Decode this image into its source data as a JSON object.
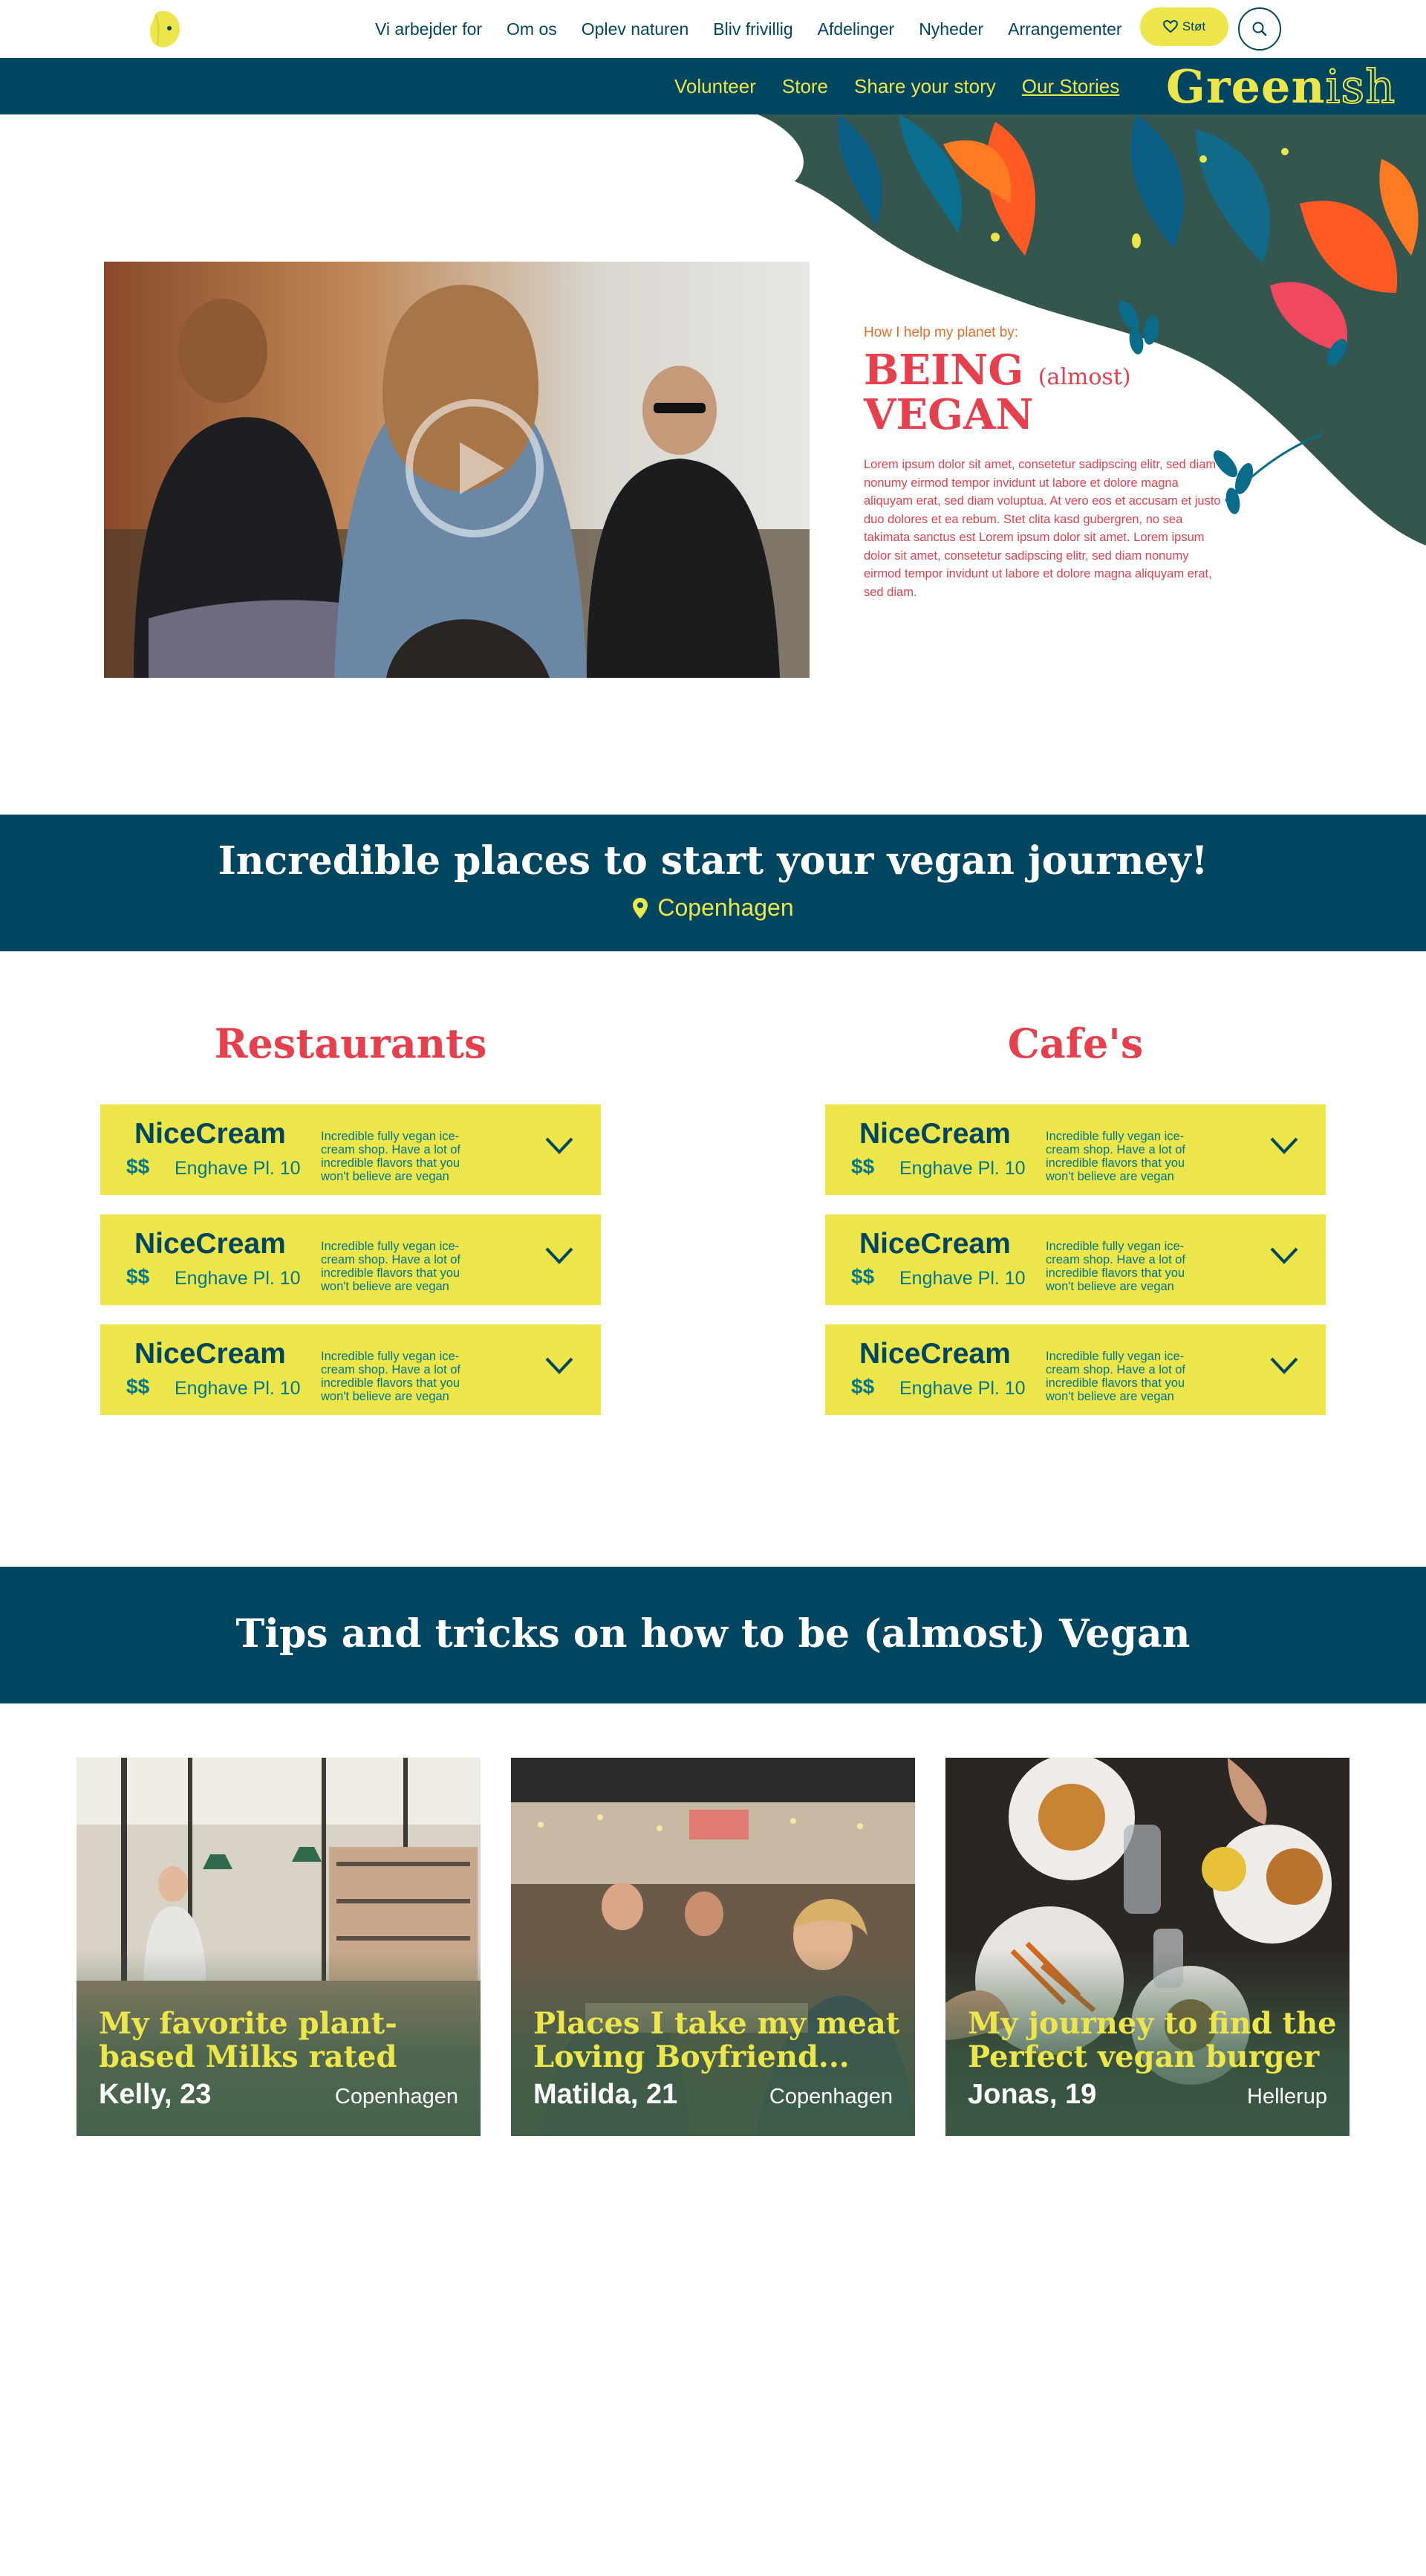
{
  "top_nav": {
    "items": [
      "Vi arbejder for",
      "Om os",
      "Oplev naturen",
      "Bliv frivillig",
      "Afdelinger",
      "Nyheder",
      "Arrangementer"
    ],
    "support_label": "Støt"
  },
  "sub_nav": {
    "items": [
      "Volunteer",
      "Store",
      "Share your story",
      "Our Stories"
    ],
    "active": "Our Stories",
    "brand_main": "Green",
    "brand_suffix": "ish"
  },
  "hero": {
    "kicker": "How I help my planet by:",
    "title_line1": "BEING",
    "title_aside": "(almost)",
    "title_line2": "VEGAN",
    "body": "Lorem ipsum dolor sit amet, consetetur sadipscing elitr, sed diam nonumy eirmod tempor invidunt ut labore et dolore magna aliquyam erat, sed diam voluptua. At vero eos et accusam et justo duo dolores et ea rebum. Stet clita kasd gubergren, no sea takimata sanctus est Lorem ipsum dolor sit amet. Lorem ipsum dolor sit amet, consetetur sadipscing elitr, sed diam nonumy eirmod tempor invidunt ut labore et dolore magna aliquyam erat, sed diam."
  },
  "places": {
    "heading": "Incredible places to start your vegan journey!",
    "location": "Copenhagen",
    "restaurants": {
      "title": "Restaurants",
      "items": [
        {
          "name": "NiceCream",
          "price": "$$",
          "address": "Enghave Pl. 10",
          "description": "Incredible fully vegan ice-cream shop. Have a lot of incredible flavors that you won't believe are vegan"
        },
        {
          "name": "NiceCream",
          "price": "$$",
          "address": "Enghave Pl. 10",
          "description": "Incredible fully vegan ice-cream shop. Have a lot of incredible flavors that you won't believe are vegan"
        },
        {
          "name": "NiceCream",
          "price": "$$",
          "address": "Enghave Pl. 10",
          "description": "Incredible fully vegan ice-cream shop. Have a lot of incredible flavors that you won't believe are vegan"
        }
      ]
    },
    "cafes": {
      "title": "Cafe's",
      "items": [
        {
          "name": "NiceCream",
          "price": "$$",
          "address": "Enghave Pl. 10",
          "description": "Incredible fully vegan ice-cream shop. Have a lot of incredible flavors that you won't believe are vegan"
        },
        {
          "name": "NiceCream",
          "price": "$$",
          "address": "Enghave Pl. 10",
          "description": "Incredible fully vegan ice-cream shop. Have a lot of incredible flavors that you won't believe are vegan"
        },
        {
          "name": "NiceCream",
          "price": "$$",
          "address": "Enghave Pl. 10",
          "description": "Incredible fully vegan ice-cream shop. Have a lot of incredible flavors that you won't believe are vegan"
        }
      ]
    }
  },
  "tips": {
    "heading": "Tips and tricks on how to be (almost) Vegan",
    "stories": [
      {
        "title": "My favorite plant-based Milks rated",
        "author": "Kelly, 23",
        "location": "Copenhagen"
      },
      {
        "title": "Places I take my meat Loving Boyfriend...",
        "author": "Matilda, 21",
        "location": "Copenhagen"
      },
      {
        "title": "My journey to find the Perfect vegan burger",
        "author": "Jonas, 19",
        "location": "Hellerup"
      }
    ]
  },
  "colors": {
    "navy": "#004660",
    "yellow": "#ece64a",
    "coral": "#e6404f",
    "teal": "#00778a",
    "orange": "#e36f2a"
  },
  "icons": {
    "logo": "yellow-leaf-logo",
    "support": "heart-icon",
    "search": "search-icon",
    "location": "map-pin-icon",
    "play": "play-icon",
    "expand": "chevron-down-icon"
  }
}
